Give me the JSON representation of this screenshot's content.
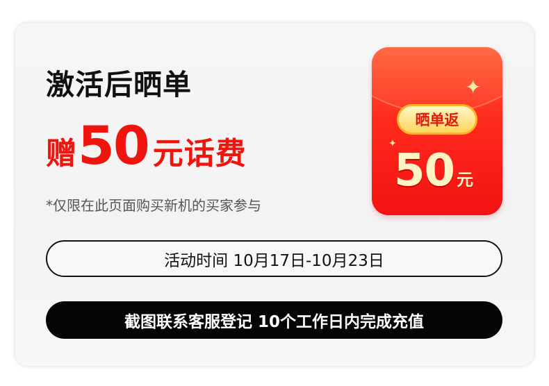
{
  "promo": {
    "headline": "激活后晒单",
    "gift_prefix": "赠",
    "gift_amount": "50",
    "gift_suffix": "元话费",
    "note": "*仅限在此页面购买新机的买家参与"
  },
  "envelope": {
    "badge": "晒单返",
    "amount": "50",
    "unit": "元"
  },
  "activity": {
    "period": "活动时间 10月17日-10月23日"
  },
  "instruction": {
    "text": "截图联系客服登记 10个工作日内完成充值"
  },
  "colors": {
    "accent_red": "#f0140e",
    "envelope_red": "#ff2a1c",
    "badge_gold": "#ffd65a",
    "dark": "#050505"
  },
  "icons": {
    "envelope": "red-envelope-icon",
    "sparkle": "sparkle-icon"
  }
}
